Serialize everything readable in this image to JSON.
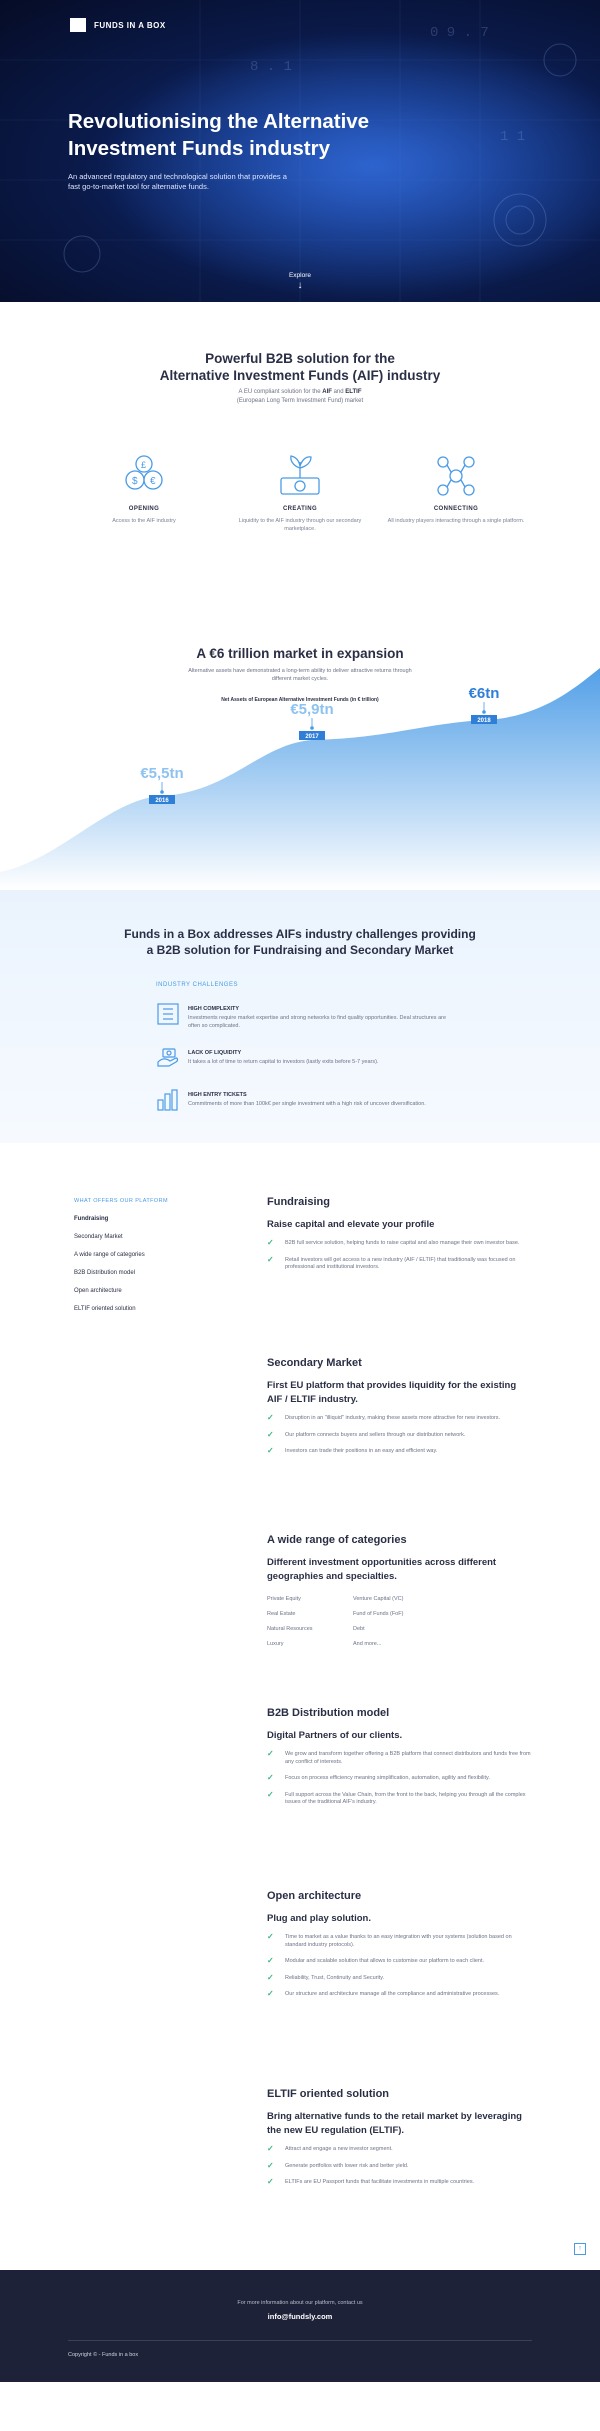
{
  "hero": {
    "brand": "FUNDS IN A BOX",
    "title": "Revolutionising the Alternative Investment Funds industry",
    "subtitle": "An advanced regulatory and technological solution that provides a fast go-to-market tool for alternative funds.",
    "explore": "Explore"
  },
  "b2b": {
    "title_line1": "Powerful B2B solution for the",
    "title_line2": "Alternative Investment Funds (AIF) industry",
    "lead_pre": "A EU compliant solution for the ",
    "lead_aif": "AIF",
    "lead_and": " and ",
    "lead_eltif": "ELTIF",
    "lead_line2": "(European Long Term Investment Fund) market",
    "features": [
      {
        "icon": "coins-icon",
        "title": "OPENING",
        "desc": "Access to the AIF industry"
      },
      {
        "icon": "money-plant-icon",
        "title": "CREATING",
        "desc": "Liquidity to the AIF industry through our secondary marketplace."
      },
      {
        "icon": "network-icon",
        "title": "CONNECTING",
        "desc": "All industry players interacting through a single platform."
      }
    ]
  },
  "market": {
    "title": "A €6 trillion market in expansion",
    "lead": "Alternative assets have demonstrated a long-term ability to deliver attractive returns through different market cycles.",
    "chart_title": "Net Assets of European Alternative Investment Funds (in € trillion)"
  },
  "chart_data": {
    "type": "area",
    "title": "Net Assets of European Alternative Investment Funds (in € trillion)",
    "categories": [
      "2016",
      "2017",
      "2018"
    ],
    "value_labels": [
      "€5,5tn",
      "€5,9tn",
      "€6tn"
    ],
    "values": [
      5.5,
      5.9,
      6.0
    ],
    "color": "#4a9be6"
  },
  "challenges": {
    "title_line1": "Funds in a Box addresses AIFs industry challenges providing",
    "title_line2": "a B2B solution for Fundraising and Secondary Market",
    "label": "INDUSTRY CHALLENGES",
    "items": [
      {
        "icon": "building-icon",
        "title": "HIGH COMPLEXITY",
        "desc": "Investments require market expertise and strong networks to find quality opportunities. Deal structures are often so complicated."
      },
      {
        "icon": "hand-money-icon",
        "title": "LACK OF LIQUIDITY",
        "desc": "It takes a lot of time to return capital to investors (lastly exits before 5-7 years)."
      },
      {
        "icon": "ticket-bars-icon",
        "title": "HIGH ENTRY TICKETS",
        "desc": "Commitments of more than 100k€ per single investment with a high risk of uncover diversification."
      }
    ]
  },
  "offers": {
    "nav_label": "WHAT OFFERS OUR PLATFORM",
    "nav": [
      "Fundraising",
      "Secondary Market",
      "A wide range of categories",
      "B2B Distribution model",
      "Open architecture",
      "ELTIF oriented solution"
    ],
    "fundraising": {
      "title": "Fundraising",
      "subtitle": "Raise capital and elevate your profile",
      "bullets": [
        "B2B full service solution, helping funds to raise capital and also manage their own investor base.",
        "Retail investors will get access to a new industry (AIF / ELTIF) that traditionally was focused on professional and institutional investors."
      ]
    },
    "secondary": {
      "title": "Secondary Market",
      "subtitle": "First EU platform that provides liquidity for the existing AIF / ELTIF industry.",
      "bullets": [
        "Disruption in an \"illiquid\" industry, making these assets more attractive for new investors.",
        "Our platform connects buyers and sellers through our distribution network.",
        "Investors can trade their positions in an easy and efficient way."
      ]
    },
    "categories": {
      "title": "A wide range of categories",
      "subtitle": "Different investment opportunities across different geographies and specialties.",
      "items": [
        "Private Equity",
        "Venture Capital (VC)",
        "Real Estate",
        "Fund of Funds (FoF)",
        "Natural Resources",
        "Debt",
        "Luxury",
        "And more..."
      ]
    },
    "distribution": {
      "title": "B2B Distribution model",
      "subtitle": "Digital Partners of our clients.",
      "bullets": [
        "We grow and transform together offering a B2B platform that connect distributors and funds free from any conflict of interests.",
        "Focus on process efficiency meaning simplification, automation, agility and flexibility.",
        "Full support across the Value Chain, from the front to the back, helping you through all the complex issues of the traditional AIF's industry."
      ]
    },
    "open": {
      "title": "Open architecture",
      "subtitle": "Plug and play solution.",
      "bullets": [
        "Time to market as a value thanks to an easy integration with your systems (solution based on standard industry protocols).",
        "Modular and scalable solution that allows to customise our platform to each client.",
        "Reliability, Trust, Continuity and Security.",
        "Our structure and architecture manage all the compliance and administrative processes."
      ]
    },
    "eltif": {
      "title": "ELTIF oriented solution",
      "subtitle": "Bring alternative funds to the retail market by leveraging the new EU regulation (ELTIF).",
      "bullets": [
        "Attract and engage a new investor segment.",
        "Generate portfolios with lower risk and better yield.",
        "ELTIFs are EU Passport funds that facilitate investments in multiple countries."
      ]
    }
  },
  "footer": {
    "info": "For more information about our platform, contact us",
    "email": "info@fundsly.com",
    "copyright": "Copyright © - Funds in a box"
  }
}
